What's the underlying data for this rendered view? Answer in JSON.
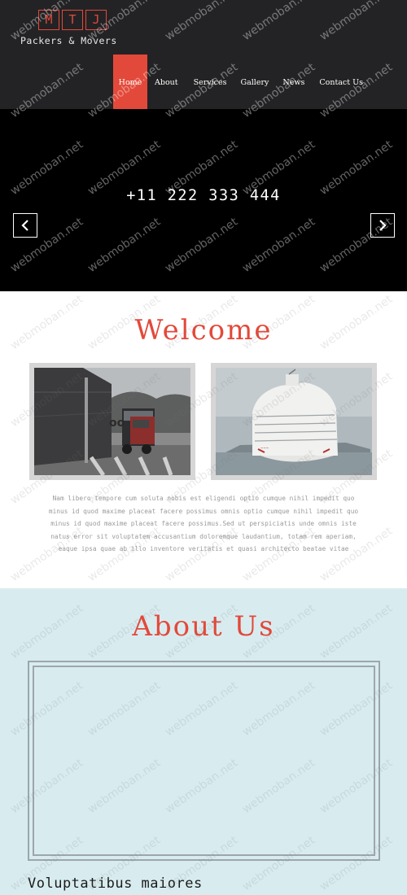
{
  "logo": {
    "letters": [
      "M",
      "T",
      "J"
    ],
    "subtitle": "Packers & Movers"
  },
  "nav": {
    "items": [
      {
        "label": "Home",
        "active": true
      },
      {
        "label": "About"
      },
      {
        "label": "Services"
      },
      {
        "label": "Gallery"
      },
      {
        "label": "News"
      },
      {
        "label": "Contact Us"
      }
    ]
  },
  "banner": {
    "phone": "+11 222 333 444",
    "prev_icon": "chevron-left-icon",
    "next_icon": "chevron-right-icon"
  },
  "welcome": {
    "title": "Welcome",
    "paragraph": "Nam libero tempore cum soluta nobis est eligendi optio cumque nihil impedit quo minus id quod maxime placeat facere possimus omnis optio cumque nihil impedit quo minus id quod maxime placeat facere possimus.Sed ut perspiciatis unde omnis iste natus error sit voluptatem accusantium doloremque laudantium, totam rem aperiam, eaque ipsa quae ab illo inventore veritatis et quasi architecto beatae vitae"
  },
  "about": {
    "title": "About Us",
    "heading": "Voluptatibus maiores"
  },
  "watermark": {
    "text": "webmoban.net"
  },
  "colors": {
    "accent": "#e3493a",
    "header_bg": "#232325",
    "banner_bg": "#000000",
    "about_bg": "#d8ecf0"
  }
}
